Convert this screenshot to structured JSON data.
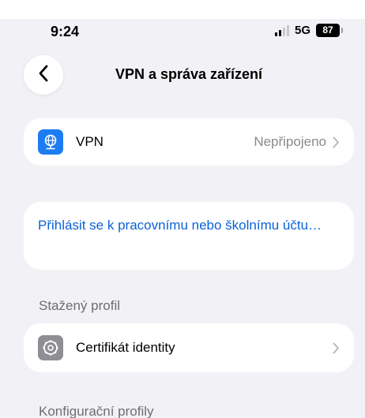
{
  "status_bar": {
    "time": "9:24",
    "network": "5G",
    "battery": "87"
  },
  "nav": {
    "title": "VPN a správa zařízení"
  },
  "vpn_row": {
    "label": "VPN",
    "value": "Nepřipojeno"
  },
  "work_account": {
    "label": "Přihlásit se k pracovnímu nebo školnímu účtu…"
  },
  "downloaded_profile": {
    "header": "Stažený profil",
    "item_label": "Certifikát identity"
  },
  "config_profiles": {
    "header": "Konfigurační profily"
  },
  "colors": {
    "background": "#f2f2f6",
    "link": "#0a62d6",
    "vpn_icon": "#1d7cf2",
    "cert_icon": "#8e8e93"
  }
}
